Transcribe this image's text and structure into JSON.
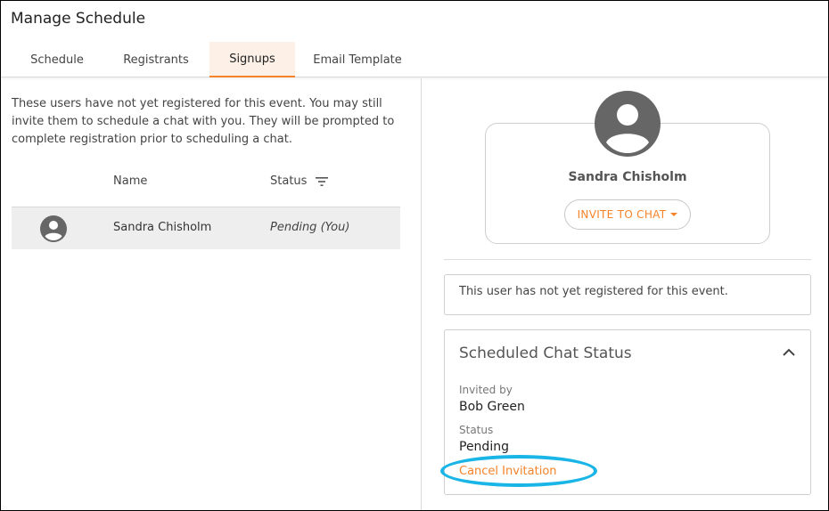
{
  "page": {
    "title": "Manage Schedule"
  },
  "tabs": [
    {
      "label": "Schedule"
    },
    {
      "label": "Registrants"
    },
    {
      "label": "Signups"
    },
    {
      "label": "Email Template"
    }
  ],
  "active_tab": "Signups",
  "intro": "These users have not yet registered for this event. You may still invite them to schedule a chat with you. They will be prompted to complete registration prior to scheduling a chat.",
  "table": {
    "headers": {
      "name": "Name",
      "status": "Status"
    },
    "rows": [
      {
        "name": "Sandra Chisholm",
        "status": "Pending (You)"
      }
    ]
  },
  "profile": {
    "name": "Sandra Chisholm",
    "invite_button": "INVITE TO CHAT"
  },
  "notice": "This user has not yet registered for this event.",
  "chat_status": {
    "title": "Scheduled Chat Status",
    "invited_by_label": "Invited by",
    "invited_by": "Bob Green",
    "status_label": "Status",
    "status": "Pending",
    "cancel_link": "Cancel Invitation"
  },
  "colors": {
    "accent": "#f5832a",
    "active_tab_bg": "#fdf1e7",
    "highlight": "#19b5e6",
    "avatar": "#666666"
  },
  "icons": {
    "filter": "filter-icon",
    "avatar": "user-avatar-icon",
    "caret": "caret-down-icon",
    "collapse": "chevron-up-icon"
  }
}
